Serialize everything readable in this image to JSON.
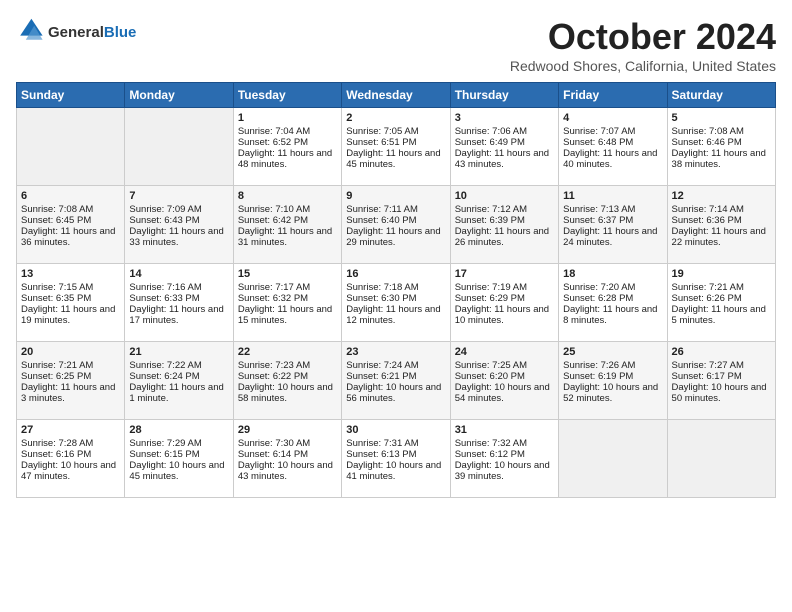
{
  "header": {
    "logo_line1": "General",
    "logo_line2": "Blue",
    "month": "October 2024",
    "location": "Redwood Shores, California, United States"
  },
  "days_of_week": [
    "Sunday",
    "Monday",
    "Tuesday",
    "Wednesday",
    "Thursday",
    "Friday",
    "Saturday"
  ],
  "weeks": [
    [
      {
        "day": "",
        "empty": true
      },
      {
        "day": "",
        "empty": true
      },
      {
        "day": "1",
        "sunrise": "Sunrise: 7:04 AM",
        "sunset": "Sunset: 6:52 PM",
        "daylight": "Daylight: 11 hours and 48 minutes."
      },
      {
        "day": "2",
        "sunrise": "Sunrise: 7:05 AM",
        "sunset": "Sunset: 6:51 PM",
        "daylight": "Daylight: 11 hours and 45 minutes."
      },
      {
        "day": "3",
        "sunrise": "Sunrise: 7:06 AM",
        "sunset": "Sunset: 6:49 PM",
        "daylight": "Daylight: 11 hours and 43 minutes."
      },
      {
        "day": "4",
        "sunrise": "Sunrise: 7:07 AM",
        "sunset": "Sunset: 6:48 PM",
        "daylight": "Daylight: 11 hours and 40 minutes."
      },
      {
        "day": "5",
        "sunrise": "Sunrise: 7:08 AM",
        "sunset": "Sunset: 6:46 PM",
        "daylight": "Daylight: 11 hours and 38 minutes."
      }
    ],
    [
      {
        "day": "6",
        "sunrise": "Sunrise: 7:08 AM",
        "sunset": "Sunset: 6:45 PM",
        "daylight": "Daylight: 11 hours and 36 minutes."
      },
      {
        "day": "7",
        "sunrise": "Sunrise: 7:09 AM",
        "sunset": "Sunset: 6:43 PM",
        "daylight": "Daylight: 11 hours and 33 minutes."
      },
      {
        "day": "8",
        "sunrise": "Sunrise: 7:10 AM",
        "sunset": "Sunset: 6:42 PM",
        "daylight": "Daylight: 11 hours and 31 minutes."
      },
      {
        "day": "9",
        "sunrise": "Sunrise: 7:11 AM",
        "sunset": "Sunset: 6:40 PM",
        "daylight": "Daylight: 11 hours and 29 minutes."
      },
      {
        "day": "10",
        "sunrise": "Sunrise: 7:12 AM",
        "sunset": "Sunset: 6:39 PM",
        "daylight": "Daylight: 11 hours and 26 minutes."
      },
      {
        "day": "11",
        "sunrise": "Sunrise: 7:13 AM",
        "sunset": "Sunset: 6:37 PM",
        "daylight": "Daylight: 11 hours and 24 minutes."
      },
      {
        "day": "12",
        "sunrise": "Sunrise: 7:14 AM",
        "sunset": "Sunset: 6:36 PM",
        "daylight": "Daylight: 11 hours and 22 minutes."
      }
    ],
    [
      {
        "day": "13",
        "sunrise": "Sunrise: 7:15 AM",
        "sunset": "Sunset: 6:35 PM",
        "daylight": "Daylight: 11 hours and 19 minutes."
      },
      {
        "day": "14",
        "sunrise": "Sunrise: 7:16 AM",
        "sunset": "Sunset: 6:33 PM",
        "daylight": "Daylight: 11 hours and 17 minutes."
      },
      {
        "day": "15",
        "sunrise": "Sunrise: 7:17 AM",
        "sunset": "Sunset: 6:32 PM",
        "daylight": "Daylight: 11 hours and 15 minutes."
      },
      {
        "day": "16",
        "sunrise": "Sunrise: 7:18 AM",
        "sunset": "Sunset: 6:30 PM",
        "daylight": "Daylight: 11 hours and 12 minutes."
      },
      {
        "day": "17",
        "sunrise": "Sunrise: 7:19 AM",
        "sunset": "Sunset: 6:29 PM",
        "daylight": "Daylight: 11 hours and 10 minutes."
      },
      {
        "day": "18",
        "sunrise": "Sunrise: 7:20 AM",
        "sunset": "Sunset: 6:28 PM",
        "daylight": "Daylight: 11 hours and 8 minutes."
      },
      {
        "day": "19",
        "sunrise": "Sunrise: 7:21 AM",
        "sunset": "Sunset: 6:26 PM",
        "daylight": "Daylight: 11 hours and 5 minutes."
      }
    ],
    [
      {
        "day": "20",
        "sunrise": "Sunrise: 7:21 AM",
        "sunset": "Sunset: 6:25 PM",
        "daylight": "Daylight: 11 hours and 3 minutes."
      },
      {
        "day": "21",
        "sunrise": "Sunrise: 7:22 AM",
        "sunset": "Sunset: 6:24 PM",
        "daylight": "Daylight: 11 hours and 1 minute."
      },
      {
        "day": "22",
        "sunrise": "Sunrise: 7:23 AM",
        "sunset": "Sunset: 6:22 PM",
        "daylight": "Daylight: 10 hours and 58 minutes."
      },
      {
        "day": "23",
        "sunrise": "Sunrise: 7:24 AM",
        "sunset": "Sunset: 6:21 PM",
        "daylight": "Daylight: 10 hours and 56 minutes."
      },
      {
        "day": "24",
        "sunrise": "Sunrise: 7:25 AM",
        "sunset": "Sunset: 6:20 PM",
        "daylight": "Daylight: 10 hours and 54 minutes."
      },
      {
        "day": "25",
        "sunrise": "Sunrise: 7:26 AM",
        "sunset": "Sunset: 6:19 PM",
        "daylight": "Daylight: 10 hours and 52 minutes."
      },
      {
        "day": "26",
        "sunrise": "Sunrise: 7:27 AM",
        "sunset": "Sunset: 6:17 PM",
        "daylight": "Daylight: 10 hours and 50 minutes."
      }
    ],
    [
      {
        "day": "27",
        "sunrise": "Sunrise: 7:28 AM",
        "sunset": "Sunset: 6:16 PM",
        "daylight": "Daylight: 10 hours and 47 minutes."
      },
      {
        "day": "28",
        "sunrise": "Sunrise: 7:29 AM",
        "sunset": "Sunset: 6:15 PM",
        "daylight": "Daylight: 10 hours and 45 minutes."
      },
      {
        "day": "29",
        "sunrise": "Sunrise: 7:30 AM",
        "sunset": "Sunset: 6:14 PM",
        "daylight": "Daylight: 10 hours and 43 minutes."
      },
      {
        "day": "30",
        "sunrise": "Sunrise: 7:31 AM",
        "sunset": "Sunset: 6:13 PM",
        "daylight": "Daylight: 10 hours and 41 minutes."
      },
      {
        "day": "31",
        "sunrise": "Sunrise: 7:32 AM",
        "sunset": "Sunset: 6:12 PM",
        "daylight": "Daylight: 10 hours and 39 minutes."
      },
      {
        "day": "",
        "empty": true
      },
      {
        "day": "",
        "empty": true
      }
    ]
  ]
}
